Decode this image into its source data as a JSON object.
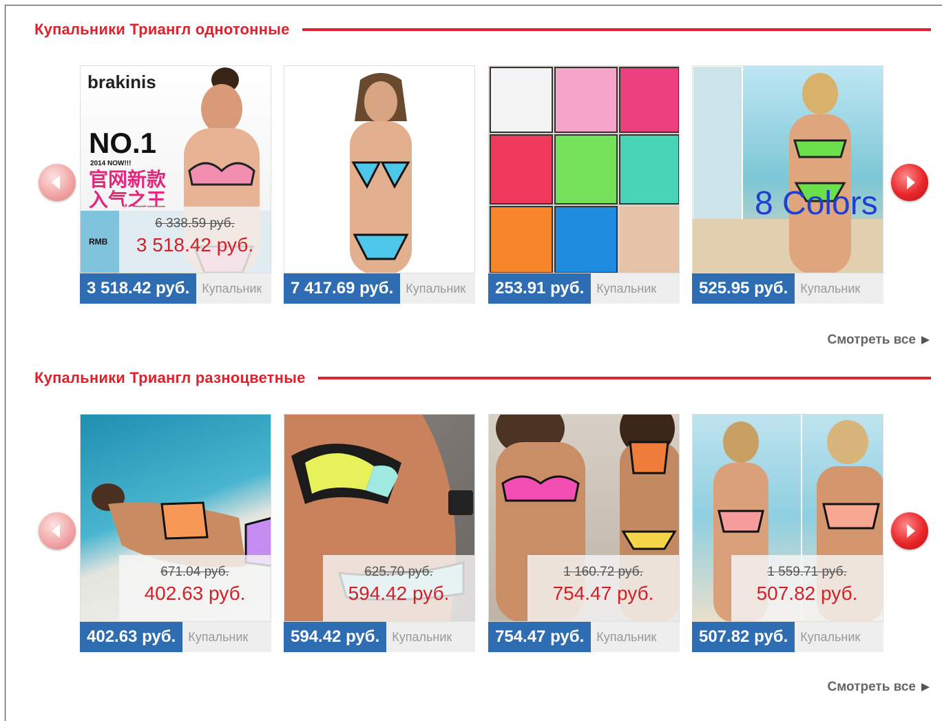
{
  "sections": [
    {
      "title": "Купальники Триангл однотонные",
      "see_all": "Смотреть все",
      "products": [
        {
          "price": "3 518.42 руб.",
          "old_price": "6 338.59 руб.",
          "new_price": "3 518.42 руб.",
          "name": "Купальник",
          "image_text": {
            "brand": "brakinis",
            "headline": "NO.1",
            "sub": "2014 NOW!!!",
            "cn_line1": "官网新款",
            "cn_line2": "入气之王",
            "rmb": "RMB"
          }
        },
        {
          "price": "7 417.69 руб.",
          "name": "Купальник"
        },
        {
          "price": "253.91 руб.",
          "name": "Купальник"
        },
        {
          "price": "525.95 руб.",
          "name": "Купальник",
          "image_text": {
            "caption": "8 Colors"
          }
        }
      ]
    },
    {
      "title": "Купальники Триангл разноцветные",
      "see_all": "Смотреть все",
      "products": [
        {
          "price": "402.63 руб.",
          "old_price": "671.04 руб.",
          "new_price": "402.63 руб.",
          "name": "Купальник"
        },
        {
          "price": "594.42 руб.",
          "old_price": "625.70 руб.",
          "new_price": "594.42 руб.",
          "name": "Купальник"
        },
        {
          "price": "754.47 руб.",
          "old_price": "1 160.72 руб.",
          "new_price": "754.47 руб.",
          "name": "Купальник"
        },
        {
          "price": "507.82 руб.",
          "old_price": "1 559.71 руб.",
          "new_price": "507.82 руб.",
          "name": "Купальник"
        }
      ]
    }
  ],
  "colors": {
    "accent": "#e0202a",
    "price_badge": "#2f6db3",
    "sale_price": "#d32028"
  },
  "icons": {
    "prev": "chevron-left-icon",
    "next": "chevron-right-icon",
    "see_all": "triangle-right-icon"
  }
}
